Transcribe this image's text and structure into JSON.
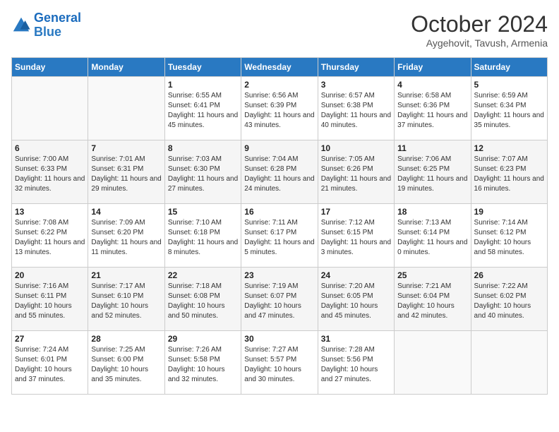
{
  "logo": {
    "line1": "General",
    "line2": "Blue"
  },
  "title": "October 2024",
  "location": "Aygehovit, Tavush, Armenia",
  "weekdays": [
    "Sunday",
    "Monday",
    "Tuesday",
    "Wednesday",
    "Thursday",
    "Friday",
    "Saturday"
  ],
  "weeks": [
    [
      {
        "day": "",
        "info": ""
      },
      {
        "day": "",
        "info": ""
      },
      {
        "day": "1",
        "info": "Sunrise: 6:55 AM\nSunset: 6:41 PM\nDaylight: 11 hours and 45 minutes."
      },
      {
        "day": "2",
        "info": "Sunrise: 6:56 AM\nSunset: 6:39 PM\nDaylight: 11 hours and 43 minutes."
      },
      {
        "day": "3",
        "info": "Sunrise: 6:57 AM\nSunset: 6:38 PM\nDaylight: 11 hours and 40 minutes."
      },
      {
        "day": "4",
        "info": "Sunrise: 6:58 AM\nSunset: 6:36 PM\nDaylight: 11 hours and 37 minutes."
      },
      {
        "day": "5",
        "info": "Sunrise: 6:59 AM\nSunset: 6:34 PM\nDaylight: 11 hours and 35 minutes."
      }
    ],
    [
      {
        "day": "6",
        "info": "Sunrise: 7:00 AM\nSunset: 6:33 PM\nDaylight: 11 hours and 32 minutes."
      },
      {
        "day": "7",
        "info": "Sunrise: 7:01 AM\nSunset: 6:31 PM\nDaylight: 11 hours and 29 minutes."
      },
      {
        "day": "8",
        "info": "Sunrise: 7:03 AM\nSunset: 6:30 PM\nDaylight: 11 hours and 27 minutes."
      },
      {
        "day": "9",
        "info": "Sunrise: 7:04 AM\nSunset: 6:28 PM\nDaylight: 11 hours and 24 minutes."
      },
      {
        "day": "10",
        "info": "Sunrise: 7:05 AM\nSunset: 6:26 PM\nDaylight: 11 hours and 21 minutes."
      },
      {
        "day": "11",
        "info": "Sunrise: 7:06 AM\nSunset: 6:25 PM\nDaylight: 11 hours and 19 minutes."
      },
      {
        "day": "12",
        "info": "Sunrise: 7:07 AM\nSunset: 6:23 PM\nDaylight: 11 hours and 16 minutes."
      }
    ],
    [
      {
        "day": "13",
        "info": "Sunrise: 7:08 AM\nSunset: 6:22 PM\nDaylight: 11 hours and 13 minutes."
      },
      {
        "day": "14",
        "info": "Sunrise: 7:09 AM\nSunset: 6:20 PM\nDaylight: 11 hours and 11 minutes."
      },
      {
        "day": "15",
        "info": "Sunrise: 7:10 AM\nSunset: 6:18 PM\nDaylight: 11 hours and 8 minutes."
      },
      {
        "day": "16",
        "info": "Sunrise: 7:11 AM\nSunset: 6:17 PM\nDaylight: 11 hours and 5 minutes."
      },
      {
        "day": "17",
        "info": "Sunrise: 7:12 AM\nSunset: 6:15 PM\nDaylight: 11 hours and 3 minutes."
      },
      {
        "day": "18",
        "info": "Sunrise: 7:13 AM\nSunset: 6:14 PM\nDaylight: 11 hours and 0 minutes."
      },
      {
        "day": "19",
        "info": "Sunrise: 7:14 AM\nSunset: 6:12 PM\nDaylight: 10 hours and 58 minutes."
      }
    ],
    [
      {
        "day": "20",
        "info": "Sunrise: 7:16 AM\nSunset: 6:11 PM\nDaylight: 10 hours and 55 minutes."
      },
      {
        "day": "21",
        "info": "Sunrise: 7:17 AM\nSunset: 6:10 PM\nDaylight: 10 hours and 52 minutes."
      },
      {
        "day": "22",
        "info": "Sunrise: 7:18 AM\nSunset: 6:08 PM\nDaylight: 10 hours and 50 minutes."
      },
      {
        "day": "23",
        "info": "Sunrise: 7:19 AM\nSunset: 6:07 PM\nDaylight: 10 hours and 47 minutes."
      },
      {
        "day": "24",
        "info": "Sunrise: 7:20 AM\nSunset: 6:05 PM\nDaylight: 10 hours and 45 minutes."
      },
      {
        "day": "25",
        "info": "Sunrise: 7:21 AM\nSunset: 6:04 PM\nDaylight: 10 hours and 42 minutes."
      },
      {
        "day": "26",
        "info": "Sunrise: 7:22 AM\nSunset: 6:02 PM\nDaylight: 10 hours and 40 minutes."
      }
    ],
    [
      {
        "day": "27",
        "info": "Sunrise: 7:24 AM\nSunset: 6:01 PM\nDaylight: 10 hours and 37 minutes."
      },
      {
        "day": "28",
        "info": "Sunrise: 7:25 AM\nSunset: 6:00 PM\nDaylight: 10 hours and 35 minutes."
      },
      {
        "day": "29",
        "info": "Sunrise: 7:26 AM\nSunset: 5:58 PM\nDaylight: 10 hours and 32 minutes."
      },
      {
        "day": "30",
        "info": "Sunrise: 7:27 AM\nSunset: 5:57 PM\nDaylight: 10 hours and 30 minutes."
      },
      {
        "day": "31",
        "info": "Sunrise: 7:28 AM\nSunset: 5:56 PM\nDaylight: 10 hours and 27 minutes."
      },
      {
        "day": "",
        "info": ""
      },
      {
        "day": "",
        "info": ""
      }
    ]
  ]
}
